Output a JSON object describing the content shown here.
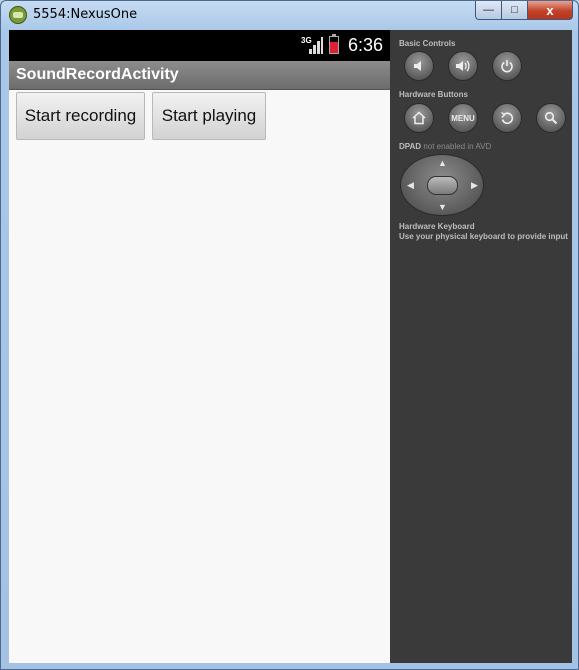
{
  "window": {
    "title": "5554:NexusOne",
    "min_label": "—",
    "max_label": "□",
    "close_label": "x"
  },
  "status_bar": {
    "network": "3G",
    "time": "6:36"
  },
  "app": {
    "title": "SoundRecordActivity",
    "buttons": {
      "record": "Start recording",
      "play": "Start playing"
    }
  },
  "controls": {
    "basic_controls_label": "Basic Controls",
    "hardware_buttons_label": "Hardware Buttons",
    "menu_label": "MENU",
    "dpad_label": "DPAD",
    "dpad_note": "not enabled in AVD",
    "keyboard_label": "Hardware Keyboard",
    "keyboard_note": "Use your physical keyboard to provide input"
  },
  "icons": [
    "emulator-app-icon",
    "signal-icon",
    "battery-icon",
    "volume-down-icon",
    "volume-up-icon",
    "power-icon",
    "home-icon",
    "back-icon",
    "search-icon"
  ]
}
